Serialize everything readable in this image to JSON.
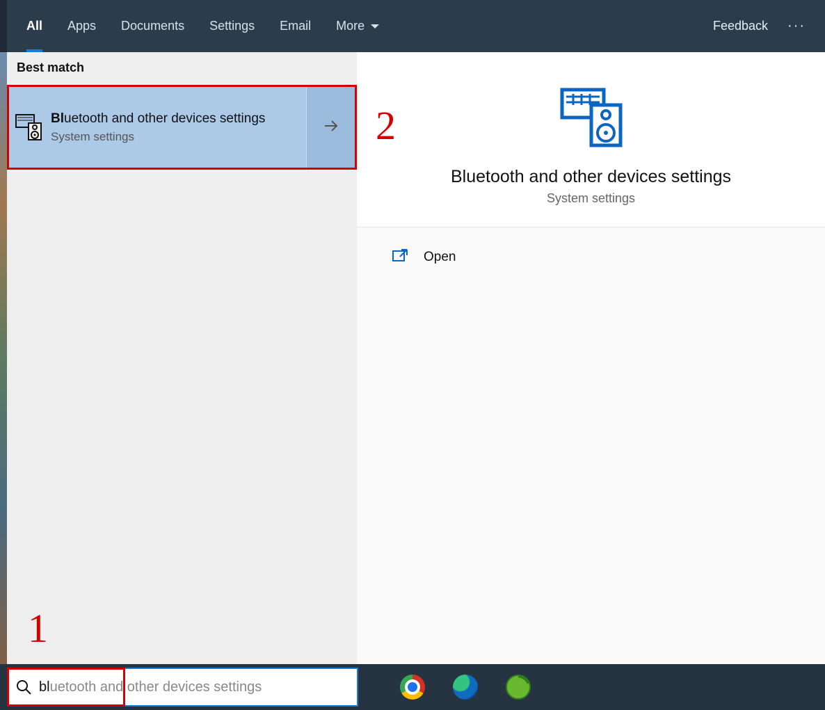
{
  "topbar": {
    "tabs": [
      {
        "label": "All",
        "active": true
      },
      {
        "label": "Apps"
      },
      {
        "label": "Documents"
      },
      {
        "label": "Settings"
      },
      {
        "label": "Email"
      },
      {
        "label": "More"
      }
    ],
    "feedback_label": "Feedback"
  },
  "results": {
    "section_header": "Best match",
    "best_match": {
      "title_bold": "Bl",
      "title_rest": "uetooth and other devices settings",
      "subtitle": "System settings"
    }
  },
  "preview": {
    "title": "Bluetooth and other devices settings",
    "subtitle": "System settings",
    "actions": [
      {
        "icon": "open",
        "label": "Open"
      }
    ]
  },
  "search": {
    "typed": "bl",
    "autocomplete": "uetooth and other devices settings"
  },
  "taskbar": {
    "apps": [
      "chrome",
      "edge",
      "coccoc"
    ]
  },
  "annotations": {
    "step1": "1",
    "step2": "2"
  }
}
